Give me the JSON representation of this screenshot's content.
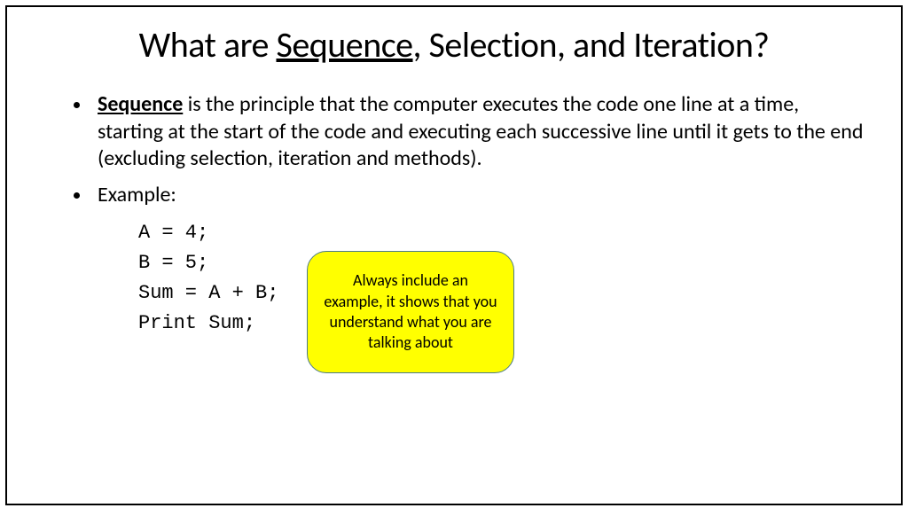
{
  "title": {
    "prefix": "What are ",
    "underlined_word": "Sequence",
    "suffix": ", Selection, and Iteration?"
  },
  "bullet1": {
    "term": "Sequence",
    "rest": " is the principle that the computer executes the code one line at a time, starting at the start of the code and executing each successive line until it gets to the end (excluding selection, iteration and methods)."
  },
  "bullet2": "Example:",
  "code": "A = 4;\nB = 5;\nSum = A + B;\nPrint Sum;",
  "callout": "Always include an example, it shows that you understand what you are talking about"
}
